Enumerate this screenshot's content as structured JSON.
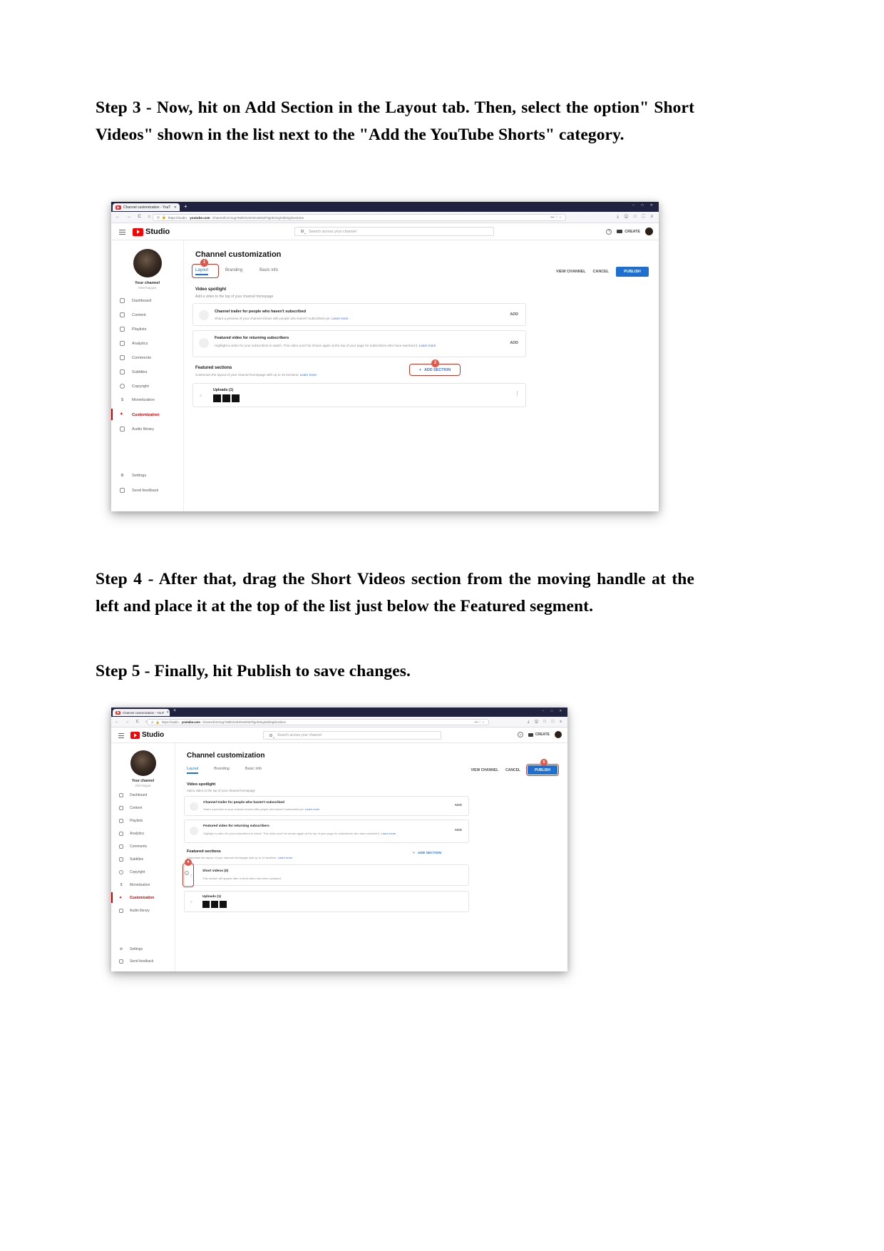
{
  "document": {
    "paragraphs": [
      "Step 3 - Now, hit on Add Section in the Layout tab. Then, select the option\" Short Videos\" shown in the list next to the \"Add the YouTube Shorts\" category.",
      "Step 4 - After that, drag the Short Videos section from the moving handle at the left and place it at the top of the list just below the Featured segment.",
      "Step 5 - Finally, hit Publish to save changes."
    ]
  },
  "screenshot_1": {
    "browser": {
      "tab_title": "Channel customization - YouT",
      "tab_close": "✕",
      "new_tab": "+",
      "window_controls": "–  □  ✕",
      "nav_icons": "← → C ⌂",
      "url_prefix": "https://studio.",
      "url_domain": "youtube.com",
      "url_path": "/channel/UCXug7Nd01hAEXKsWSZFiignkOng/editing/sections",
      "url_overflow": "••• ♡ ☆",
      "toolbar_right": "⤓ ⓘ □ ⬚ ≡"
    },
    "studio_header": {
      "logo_word": "Studio",
      "search_placeholder": "Search across your channel",
      "help_icon": "?",
      "create_label": "CREATE"
    },
    "sidebar": {
      "channel_label": "Your channel",
      "channel_name": "Vinit Nayyar",
      "items": [
        {
          "label": "Dashboard",
          "icon": "dashboard-icon"
        },
        {
          "label": "Content",
          "icon": "content-icon"
        },
        {
          "label": "Playlists",
          "icon": "playlists-icon"
        },
        {
          "label": "Analytics",
          "icon": "analytics-icon"
        },
        {
          "label": "Comments",
          "icon": "comments-icon"
        },
        {
          "label": "Subtitles",
          "icon": "subtitles-icon"
        },
        {
          "label": "Copyright",
          "icon": "copyright-icon"
        },
        {
          "label": "Monetization",
          "icon": "monetization-icon"
        },
        {
          "label": "Customization",
          "icon": "customization-icon"
        },
        {
          "label": "Audio library",
          "icon": "audio-library-icon"
        }
      ],
      "footer_items": [
        {
          "label": "Settings",
          "icon": "gear-icon"
        },
        {
          "label": "Send feedback",
          "icon": "feedback-icon"
        }
      ],
      "active_item": "Customization"
    },
    "main": {
      "page_title": "Channel customization",
      "tabs": [
        {
          "label": "Layout",
          "selected": true
        },
        {
          "label": "Branding",
          "selected": false
        },
        {
          "label": "Basic info",
          "selected": false
        }
      ],
      "callout_badge": "1",
      "actions": {
        "view_channel": "VIEW CHANNEL",
        "cancel": "CANCEL",
        "publish": "PUBLISH"
      },
      "video_spotlight": {
        "heading": "Video spotlight",
        "subheading": "Add a video to the top of your channel homepage",
        "cards": [
          {
            "title": "Channel trailer for people who haven't subscribed",
            "desc": "Share a preview of your channel shown with people who haven't subscribed yet.",
            "link": "Learn more",
            "action": "ADD"
          },
          {
            "title": "Featured video for returning subscribers",
            "desc": "Highlight a video for your subscribers to watch. This video won't be shown again at the top of your page for subscribers who have watched it.",
            "link": "Learn more",
            "action": "ADD"
          }
        ]
      },
      "featured_sections": {
        "heading": "Featured sections",
        "subheading": "Customize the layout of your channel homepage with up to 10 sections.",
        "link": "Learn more",
        "add_section_label": "ADD SECTION",
        "add_section_icon": "plus-icon",
        "badge": "2",
        "rows": [
          {
            "title": "Uploads (1)",
            "subtitle": "",
            "handle": "drag-handle-icon",
            "menu": "kebab-menu-icon"
          }
        ]
      }
    }
  },
  "screenshot_2": {
    "browser": {
      "tab_title": "Channel customization - YouT",
      "tab_close": "✕",
      "new_tab": "+",
      "window_controls": "–  □  ✕",
      "nav_icons": "← → C ⌂",
      "url_prefix": "https://studio.",
      "url_domain": "youtube.com",
      "url_path": "/channel/UCXug7Nd01hAEXKsWSZFiignkOng/editing/sections",
      "url_overflow": "••• ♡ ☆",
      "toolbar_right": "⤓ ⓘ □ ⬚ ≡"
    },
    "studio_header": {
      "logo_word": "Studio",
      "search_placeholder": "Search across your channel",
      "help_icon": "?",
      "create_label": "CREATE"
    },
    "sidebar": {
      "channel_label": "Your channel",
      "channel_name": "Vinit Nayyar",
      "items": [
        {
          "label": "Dashboard",
          "icon": "dashboard-icon"
        },
        {
          "label": "Content",
          "icon": "content-icon"
        },
        {
          "label": "Playlists",
          "icon": "playlists-icon"
        },
        {
          "label": "Analytics",
          "icon": "analytics-icon"
        },
        {
          "label": "Comments",
          "icon": "comments-icon"
        },
        {
          "label": "Subtitles",
          "icon": "subtitles-icon"
        },
        {
          "label": "Copyright",
          "icon": "copyright-icon"
        },
        {
          "label": "Monetization",
          "icon": "monetization-icon"
        },
        {
          "label": "Customization",
          "icon": "customization-icon"
        },
        {
          "label": "Audio library",
          "icon": "audio-library-icon"
        }
      ],
      "footer_items": [
        {
          "label": "Settings",
          "icon": "gear-icon"
        },
        {
          "label": "Send feedback",
          "icon": "feedback-icon"
        }
      ],
      "active_item": "Customization"
    },
    "main": {
      "page_title": "Channel customization",
      "tabs": [
        {
          "label": "Layout",
          "selected": true
        },
        {
          "label": "Branding",
          "selected": false
        },
        {
          "label": "Basic info",
          "selected": false
        }
      ],
      "callout_badge": "5",
      "actions": {
        "view_channel": "VIEW CHANNEL",
        "cancel": "CANCEL",
        "publish": "PUBLISH"
      },
      "video_spotlight": {
        "heading": "Video spotlight",
        "subheading": "Add a video to the top of your channel homepage",
        "cards": [
          {
            "title": "Channel trailer for people who haven't subscribed",
            "desc": "Share a preview of your channel shown with people who haven't subscribed yet.",
            "link": "Learn more",
            "action": "ADD"
          },
          {
            "title": "Featured video for returning subscribers",
            "desc": "Highlight a video for your subscribers to watch. This video won't be shown again at the top of your page for subscribers who have watched it.",
            "link": "Learn more",
            "action": "ADD"
          }
        ]
      },
      "featured_sections": {
        "heading": "Featured sections",
        "subheading": "Customize the layout of your channel homepage with up to 10 sections.",
        "link": "Learn more",
        "add_section_label": "ADD SECTION",
        "add_section_icon": "plus-icon",
        "badge": "4",
        "rows": [
          {
            "title": "Short videos (0)",
            "subtitle": "This section will appear after a short video has been uploaded.",
            "handle": "drag-handle-icon",
            "info": "info-icon"
          },
          {
            "title": "Uploads (1)",
            "subtitle": "",
            "handle": "drag-handle-icon",
            "menu": "kebab-menu-icon"
          }
        ]
      }
    }
  },
  "colors": {
    "accent_red": "#cc0000",
    "publish_blue": "#1f6fd0",
    "callout_red": "#c0392b",
    "link_blue": "#3b6fd4",
    "chrome_dark": "#202340"
  }
}
